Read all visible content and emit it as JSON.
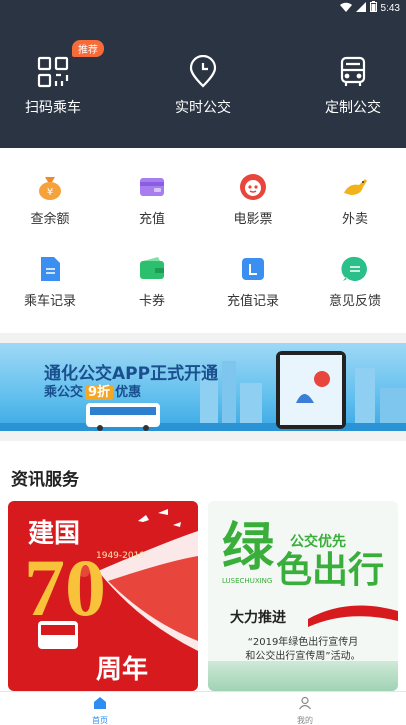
{
  "status": {
    "time": "5:43"
  },
  "header": {
    "badge": "推荐",
    "items": [
      {
        "label": "扫码乘车",
        "icon": "qr-scan-icon"
      },
      {
        "label": "实时公交",
        "icon": "location-pin-icon"
      },
      {
        "label": "定制公交",
        "icon": "bus-icon"
      }
    ]
  },
  "grid": {
    "items": [
      {
        "label": "查余额",
        "icon": "money-bag-icon"
      },
      {
        "label": "充值",
        "icon": "wallet-icon"
      },
      {
        "label": "电影票",
        "icon": "movie-cat-icon"
      },
      {
        "label": "外卖",
        "icon": "kangaroo-icon"
      },
      {
        "label": "乘车记录",
        "icon": "document-icon"
      },
      {
        "label": "卡券",
        "icon": "card-wallet-icon"
      },
      {
        "label": "充值记录",
        "icon": "recharge-record-icon"
      },
      {
        "label": "意见反馈",
        "icon": "feedback-icon"
      }
    ]
  },
  "banner": {
    "title": "通化公交APP正式开通",
    "sub_prefix": "乘公交",
    "sub_highlight": "9折",
    "sub_suffix": "优惠"
  },
  "news": {
    "title": "资讯服务",
    "card_left": {
      "line1": "建国",
      "years": "1949-2019",
      "big": "70",
      "line2": "周年"
    },
    "card_right": {
      "big_green": "绿",
      "small": "公交优先",
      "pinyin": "LUSECHUXING",
      "rest": "色出行",
      "slogan": "大力推进",
      "desc1": "“2019年绿色出行宣传月",
      "desc2": "和公交出行宣传周”活动。"
    }
  },
  "tabbar": {
    "items": [
      {
        "label": "首页",
        "icon": "home-icon",
        "active": true
      },
      {
        "label": "我的",
        "icon": "user-icon",
        "active": false
      }
    ]
  },
  "colors": {
    "header_bg": "#2b3442",
    "accent": "#2f8cf0",
    "badge": "#f76a3a"
  }
}
